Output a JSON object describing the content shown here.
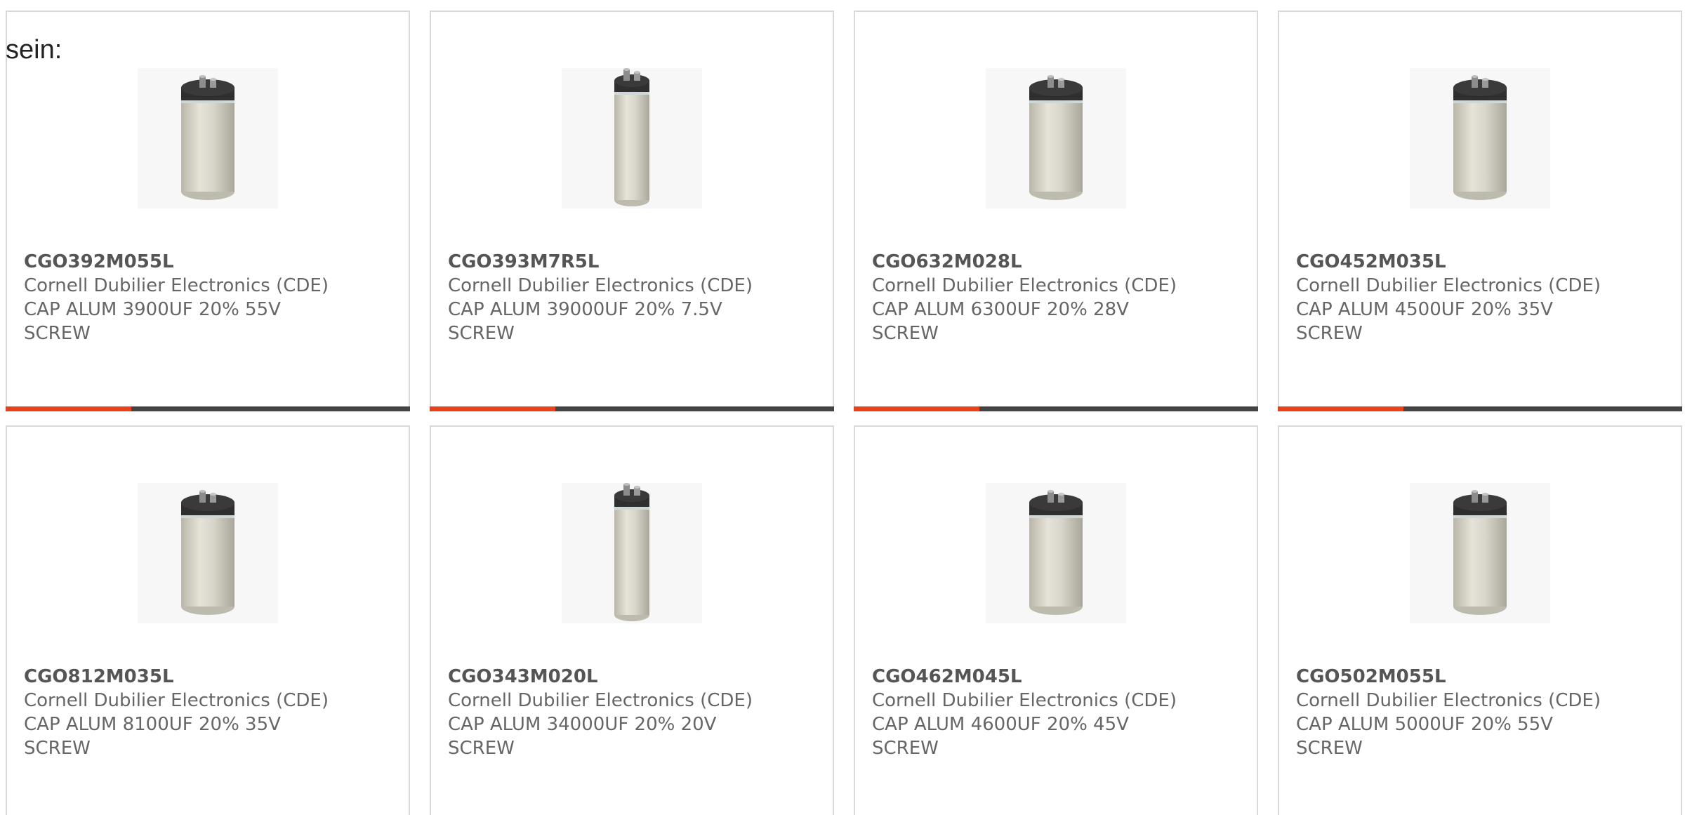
{
  "intro_text": "sein:",
  "colors": {
    "accent": "#e8421a",
    "bar_track": "#444444",
    "card_border": "#d9d9d9",
    "text": "#666666"
  },
  "product_image_icon": "capacitor-icon",
  "products": [
    {
      "part_number": "CGO392M055L",
      "manufacturer": "Cornell Dubilier Electronics (CDE)",
      "description": "CAP ALUM 3900UF 20% 55V",
      "mount": "SCREW",
      "slim": false,
      "progress": 0.31
    },
    {
      "part_number": "CGO393M7R5L",
      "manufacturer": "Cornell Dubilier Electronics (CDE)",
      "description": "CAP ALUM 39000UF 20% 7.5V",
      "mount": "SCREW",
      "slim": true,
      "progress": 0.31
    },
    {
      "part_number": "CGO632M028L",
      "manufacturer": "Cornell Dubilier Electronics (CDE)",
      "description": "CAP ALUM 6300UF 20% 28V",
      "mount": "SCREW",
      "slim": false,
      "progress": 0.31
    },
    {
      "part_number": "CGO452M035L",
      "manufacturer": "Cornell Dubilier Electronics (CDE)",
      "description": "CAP ALUM 4500UF 20% 35V",
      "mount": "SCREW",
      "slim": false,
      "progress": 0.31
    },
    {
      "part_number": "CGO812M035L",
      "manufacturer": "Cornell Dubilier Electronics (CDE)",
      "description": "CAP ALUM 8100UF 20% 35V",
      "mount": "SCREW",
      "slim": false,
      "progress": null
    },
    {
      "part_number": "CGO343M020L",
      "manufacturer": "Cornell Dubilier Electronics (CDE)",
      "description": "CAP ALUM 34000UF 20% 20V",
      "mount": "SCREW",
      "slim": true,
      "progress": null
    },
    {
      "part_number": "CGO462M045L",
      "manufacturer": "Cornell Dubilier Electronics (CDE)",
      "description": "CAP ALUM 4600UF 20% 45V",
      "mount": "SCREW",
      "slim": false,
      "progress": null
    },
    {
      "part_number": "CGO502M055L",
      "manufacturer": "Cornell Dubilier Electronics (CDE)",
      "description": "CAP ALUM 5000UF 20% 55V",
      "mount": "SCREW",
      "slim": false,
      "progress": null
    }
  ]
}
